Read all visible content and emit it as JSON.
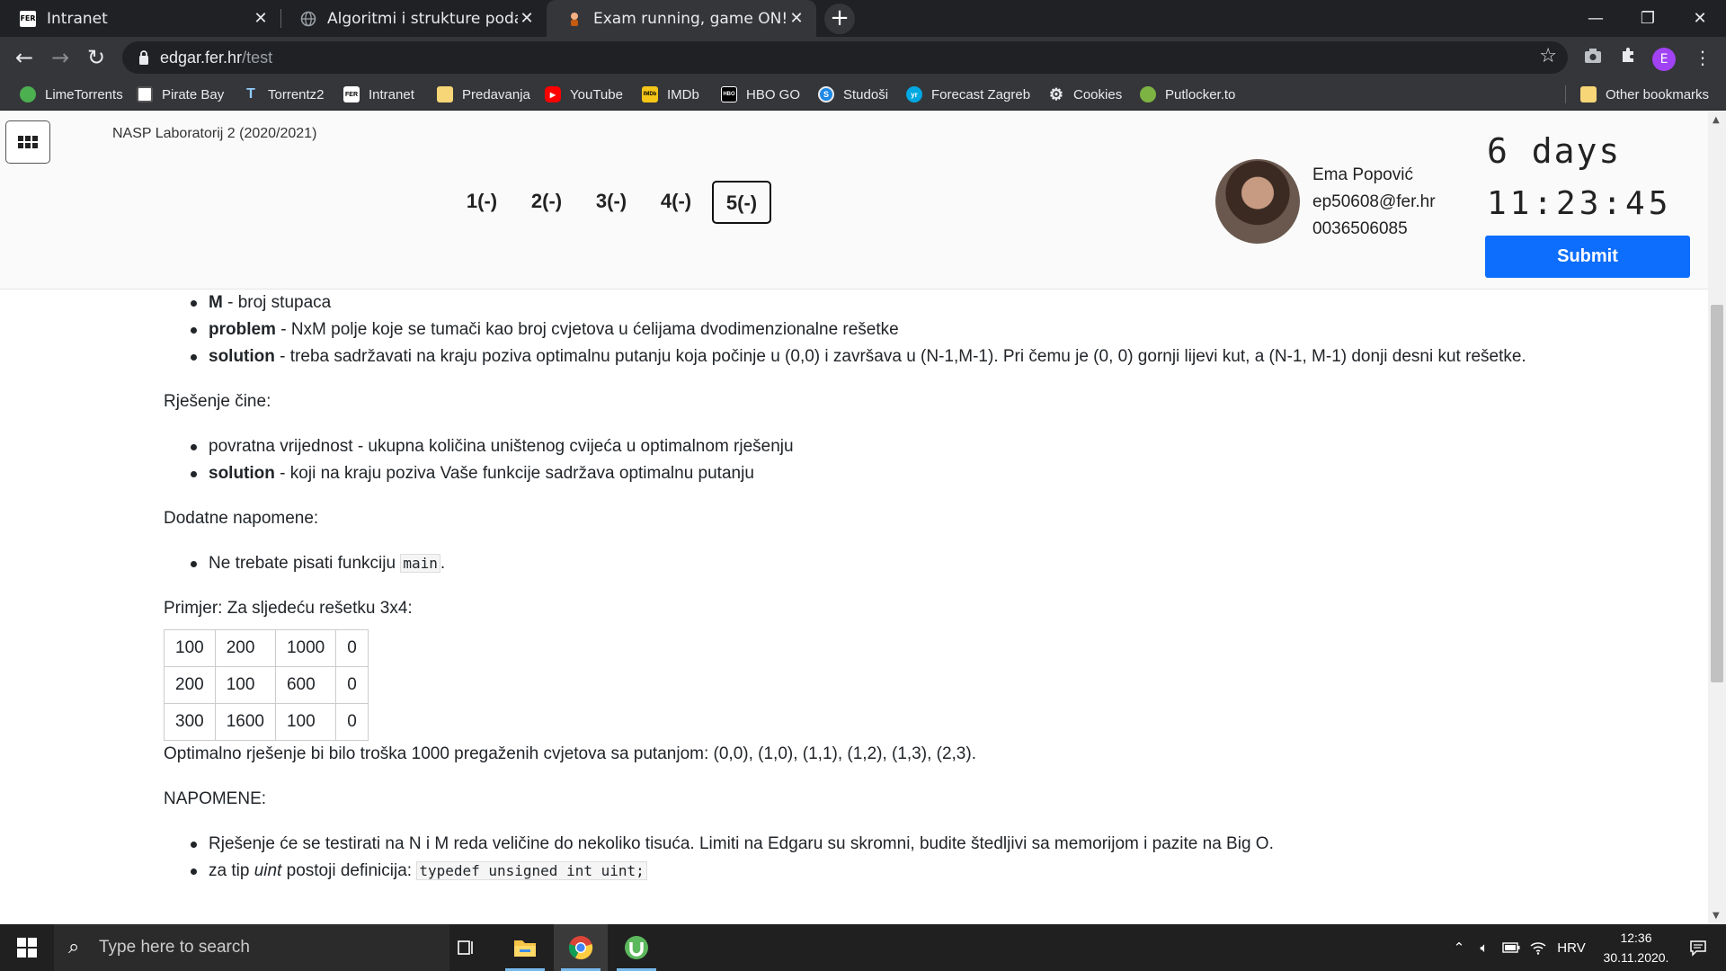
{
  "browser": {
    "tabs": [
      {
        "title": "Intranet",
        "favicon": "fer-icon"
      },
      {
        "title": "Algoritmi i strukture podataka",
        "favicon": "globe-icon"
      },
      {
        "title": "Exam running, game ON!",
        "favicon": "edgar-icon"
      }
    ],
    "url_host": "edgar.fer.hr",
    "url_path": "/test",
    "profile_initial": "E",
    "bookmarks": [
      {
        "label": "LimeTorrents",
        "icon": "lime-icon",
        "color": "#4caf50"
      },
      {
        "label": "Pirate Bay",
        "icon": "ship-icon",
        "color": "#9e9e9e"
      },
      {
        "label": "Torrentz2",
        "icon": "t-icon",
        "color": "#2196f3"
      },
      {
        "label": "Intranet",
        "icon": "fer-icon",
        "color": "#111111"
      },
      {
        "label": "Predavanja",
        "icon": "folder-icon",
        "color": "#f6d677"
      },
      {
        "label": "YouTube",
        "icon": "youtube-icon",
        "color": "#ff0000"
      },
      {
        "label": "IMDb",
        "icon": "imdb-icon",
        "color": "#f5c518"
      },
      {
        "label": "HBO GO",
        "icon": "hbo-icon",
        "color": "#000000"
      },
      {
        "label": "Studoši",
        "icon": "s-icon",
        "color": "#1e88e5"
      },
      {
        "label": "Forecast Zagreb",
        "icon": "yr-icon",
        "color": "#00a8e1"
      },
      {
        "label": "Cookies",
        "icon": "gear-icon",
        "color": "#e8eaed"
      },
      {
        "label": "Putlocker.to",
        "icon": "reel-icon",
        "color": "#7cb342"
      }
    ],
    "other_bookmarks": "Other bookmarks"
  },
  "header": {
    "course": "NASP Laboratorij 2 (2020/2021)",
    "questions": [
      "1(-)",
      "2(-)",
      "3(-)",
      "4(-)",
      "5(-)"
    ],
    "current_question_index": 4,
    "user_name": "Ema Popović",
    "user_email": "ep50608@fer.hr",
    "user_id": "0036506085",
    "timer_days": "6 days",
    "timer_time": "11:23:45",
    "submit_label": "Submit",
    "accent_color": "#0d6efd"
  },
  "content": {
    "params": [
      {
        "term": "M",
        "text": " - broj stupaca"
      },
      {
        "term": "problem",
        "text": " - NxM polje koje se tumači kao broj cvjetova u ćelijama dvodimenzionalne rešetke"
      },
      {
        "term": "solution",
        "text": " - treba sadržavati na kraju poziva optimalnu putanju koja počinje u (0,0) i završava u (N-1,M-1). Pri čemu je (0, 0) gornji lijevi kut, a (N-1, M-1) donji desni kut rešetke."
      }
    ],
    "solution_heading": "Rješenje čine:",
    "solution_items": [
      {
        "term": "",
        "text": "povratna vrijednost - ukupna količina uništenog cvijeća u optimalnom rješenju"
      },
      {
        "term": "solution",
        "text": " - koji na kraju poziva Vaše funkcije sadržava optimalnu putanju"
      }
    ],
    "notes_heading": "Dodatne napomene:",
    "note_text": "Ne trebate pisati funkciju ",
    "note_code": "main",
    "note_end": ".",
    "example_heading": "Primjer: Za sljedeću rešetku 3x4:",
    "example_table": [
      [
        "100",
        "200",
        "1000",
        "0"
      ],
      [
        "200",
        "100",
        "600",
        "0"
      ],
      [
        "300",
        "1600",
        "100",
        "0"
      ]
    ],
    "example_result": "Optimalno rješenje bi bilo troška 1000 pregaženih cvjetova sa putanjom: (0,0), (1,0), (1,1), (1,2), (1,3), (2,3).",
    "napomene_heading": "NAPOMENE:",
    "napomene_item1": "Rješenje će se testirati na N i M reda veličine do nekoliko tisuća. Limiti na Edgaru su skromni, budite štedljivi sa memorijom i pazite na Big O.",
    "napomene_item2_pre": "za tip ",
    "napomene_item2_em": "uint",
    "napomene_item2_mid": " postoji definicija: ",
    "napomene_item2_code": "typedef unsigned int uint;"
  },
  "taskbar": {
    "search_placeholder": "Type here to search",
    "language": "HRV",
    "time": "12:36",
    "date": "30.11.2020."
  }
}
